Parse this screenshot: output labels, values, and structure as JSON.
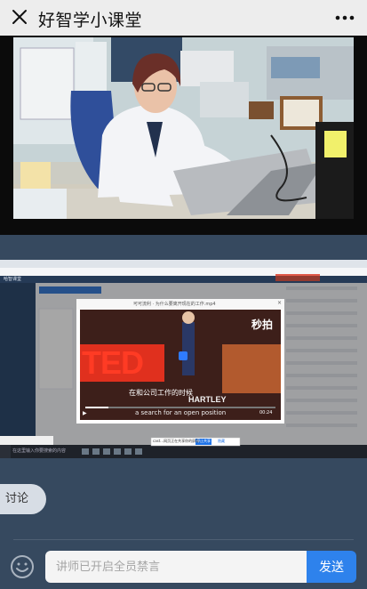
{
  "header": {
    "title": "好智学小课堂",
    "close_icon": "close-icon",
    "more_icon": "more-icon"
  },
  "video": {
    "description_icon": "teacher-video",
    "colors": {
      "background": "#0b0b0b",
      "wall": "#cfd9dc",
      "coat": "#f3f4f7"
    }
  },
  "screen_share": {
    "app_title": "哈智课堂",
    "modal_title": "可可流利 · 为什么要离开现在的工作.mp4",
    "brand_text": "秒拍",
    "ted_text": "TED",
    "subtitle_cn": "在和公司工作的时候",
    "subtitle_en": "a search for an open position",
    "speaker_text": "HARTLEY",
    "timer": "00:24",
    "taskbar_search": "在这里输入你要搜索的内容",
    "toast_text": "cast...网页正在共享你的屏幕...",
    "toast_button": "停止共享",
    "toast_hide": "隐藏"
  },
  "discussion": {
    "tab_label": "讨论"
  },
  "input": {
    "placeholder": "讲师已开启全员禁言",
    "send_label": "发送",
    "emoji_icon": "emoji-icon"
  },
  "colors": {
    "accent": "#2e82ec",
    "page_bg": "#36495f",
    "topbar_bg": "#ededed"
  }
}
